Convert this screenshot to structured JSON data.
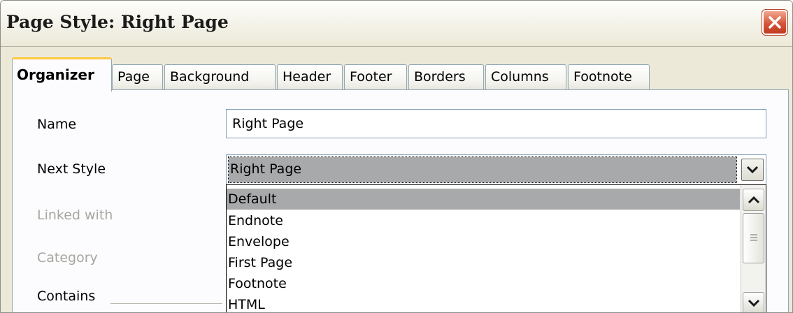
{
  "window": {
    "title": "Page Style: Right Page"
  },
  "tabs": [
    {
      "label": "Organizer",
      "active": true
    },
    {
      "label": "Page"
    },
    {
      "label": "Background"
    },
    {
      "label": "Header"
    },
    {
      "label": "Footer"
    },
    {
      "label": "Borders"
    },
    {
      "label": "Columns"
    },
    {
      "label": "Footnote"
    }
  ],
  "form": {
    "name_label": "Name",
    "name_value": "Right Page",
    "next_style_label": "Next Style",
    "next_style_value": "Right Page",
    "linked_with_label": "Linked with",
    "category_label": "Category",
    "contains_label": "Contains"
  },
  "dropdown": {
    "options": [
      "Default",
      "Endnote",
      "Envelope",
      "First Page",
      "Footnote",
      "HTML"
    ],
    "highlighted": "Default"
  },
  "colors": {
    "dialog_bg": "#ece9d8",
    "panel_bg": "#fcfcfe",
    "selection": "#a7a9ab",
    "active_tab_accent": "#ffc83c",
    "close_button": "#d5563a"
  },
  "icons": {
    "close": "close-icon",
    "combo_arrow": "chevron-down-icon",
    "scroll_up": "chevron-up-icon",
    "scroll_down": "chevron-down-icon"
  }
}
